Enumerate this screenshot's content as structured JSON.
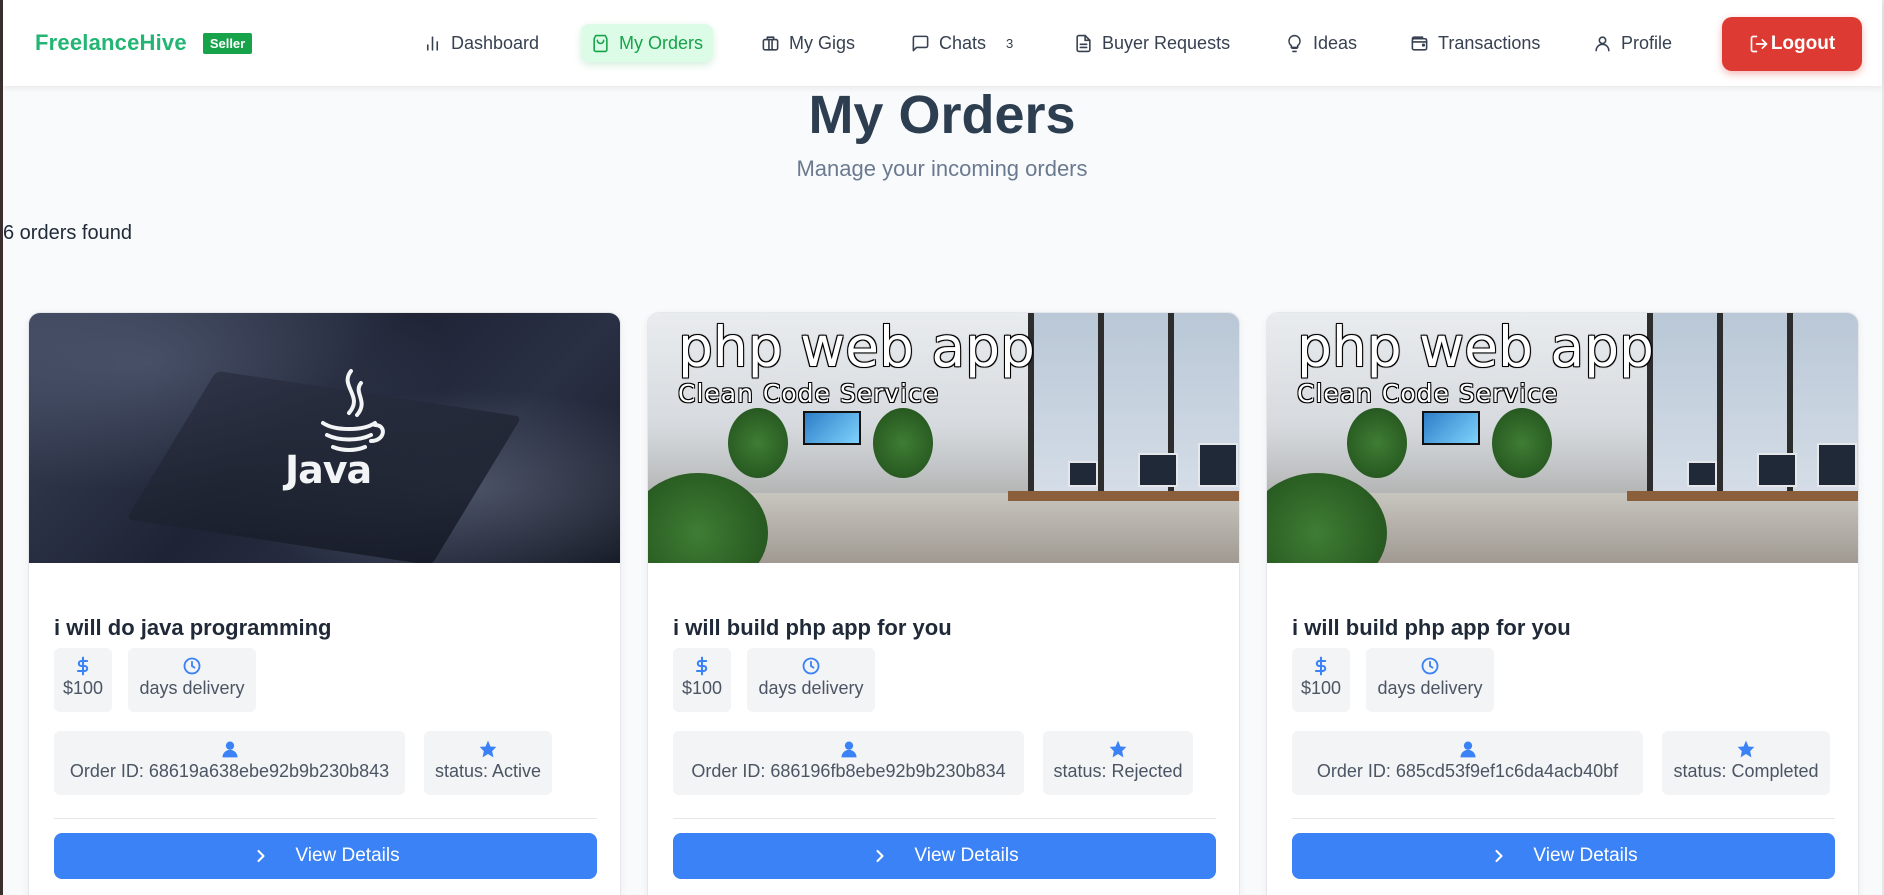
{
  "brand": {
    "name": "FreelanceHive",
    "badge": "Seller"
  },
  "nav": {
    "dashboard": "Dashboard",
    "my_orders": "My Orders",
    "my_gigs": "My Gigs",
    "chats": "Chats",
    "chats_count": "3",
    "buyer_requests": "Buyer Requests",
    "ideas": "Ideas",
    "transactions": "Transactions",
    "profile": "Profile",
    "logout": "Logout",
    "active": "My Orders"
  },
  "header": {
    "title": "My Orders",
    "subtitle": "Manage your incoming orders",
    "count": "6 orders found"
  },
  "colors": {
    "brand_green": "#22b573",
    "logout_red": "#dc3a32",
    "primary_blue": "#3b82f6",
    "icon_blue": "#3b82f6"
  },
  "orders": [
    {
      "image": "java-logo-image",
      "image_text": "Java",
      "title": "i will do java programming",
      "price": "$100",
      "delivery": "days delivery",
      "order_id": "Order ID: 68619a638ebe92b9b230b843",
      "status": "status: Active",
      "button": "View Details"
    },
    {
      "image": "office-image",
      "image_title": "php web app",
      "image_subtitle": "Clean Code Service",
      "title": "i will build php app for you",
      "price": "$100",
      "delivery": "days delivery",
      "order_id": "Order ID: 686196fb8ebe92b9b230b834",
      "status": "status: Rejected",
      "button": "View Details"
    },
    {
      "image": "office-image",
      "image_title": "php web app",
      "image_subtitle": "Clean Code Service",
      "title": "i will build php app for you",
      "price": "$100",
      "delivery": "days delivery",
      "order_id": "Order ID: 685cd53f9ef1c6da4acb40bf",
      "status": "status: Completed",
      "button": "View Details"
    }
  ]
}
